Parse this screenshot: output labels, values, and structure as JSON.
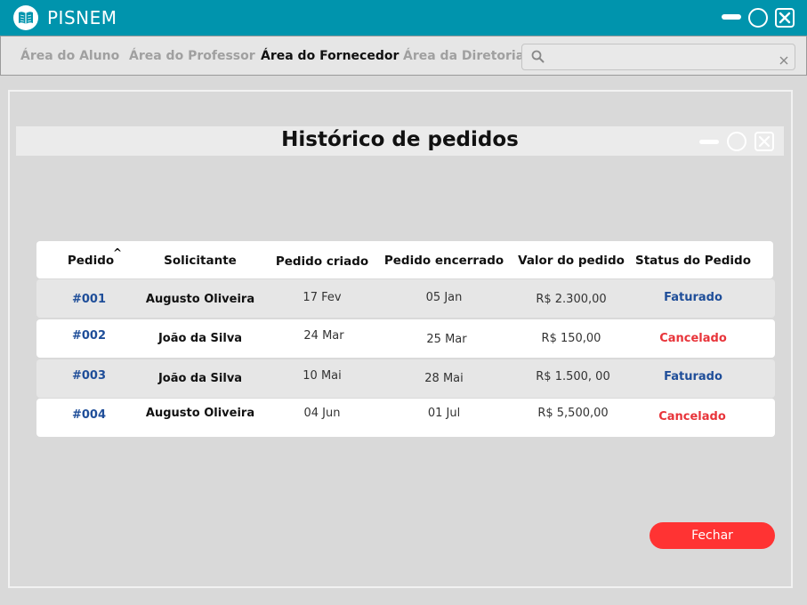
{
  "app": {
    "title": "PISNEM",
    "logo_icon": "book-icon"
  },
  "nav": {
    "items": [
      {
        "label": "Área do Aluno",
        "active": false
      },
      {
        "label": "Área do Professor",
        "active": false
      },
      {
        "label": "Área do Fornecedor",
        "active": true
      },
      {
        "label": "Área da Diretoria",
        "active": false
      }
    ],
    "search": {
      "value": "",
      "placeholder": ""
    }
  },
  "dialog": {
    "title": "Histórico de pedidos"
  },
  "table": {
    "headers": [
      "Pedido",
      "Solicitante",
      "Pedido criado",
      "Pedido encerrado",
      "Valor do pedido",
      "Status do Pedido"
    ],
    "sort_indicator": "^",
    "rows": [
      {
        "id": "#001",
        "requester": "Augusto Oliveira",
        "created": "17 Fev",
        "closed": "05 Jan",
        "value": "R$ 2.300,00",
        "status": "Faturado"
      },
      {
        "id": "#002",
        "requester": "João da Silva",
        "created": "24 Mar",
        "closed": "25 Mar",
        "value": "R$ 150,00",
        "status": "Cancelado"
      },
      {
        "id": "#003",
        "requester": "João da Silva",
        "created": "10 Mai",
        "closed": "28 Mai",
        "value": "R$ 1.500, 00",
        "status": "Faturado"
      },
      {
        "id": "#004",
        "requester": "Augusto Oliveira",
        "created": "04 Jun",
        "closed": "01 Jul",
        "value": "R$  5,500,00",
        "status": "Cancelado"
      }
    ]
  },
  "actions": {
    "close_label": "Fechar"
  },
  "colors": {
    "titlebar": "#0094ad",
    "status_faturado": "#1f4e99",
    "status_cancelado": "#e8343a",
    "close_button": "#ff3333"
  }
}
